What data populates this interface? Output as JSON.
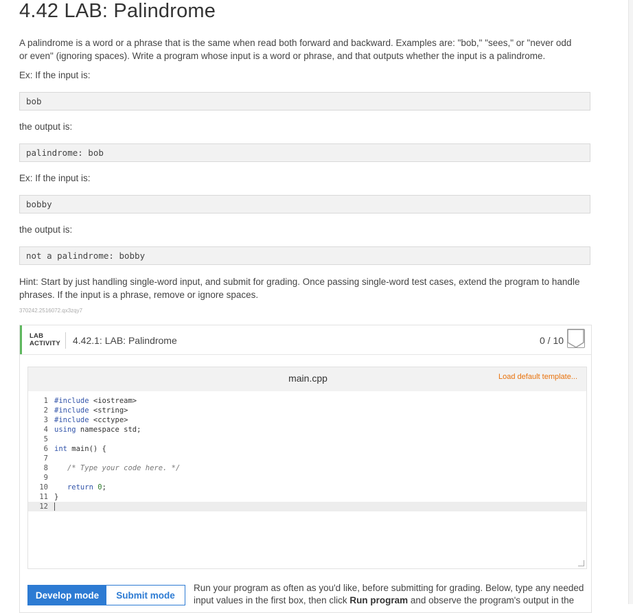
{
  "title": "4.42 LAB: Palindrome",
  "description": "A palindrome is a word or a phrase that is the same when read both forward and backward. Examples are: \"bob,\" \"sees,\" or \"never odd or even\" (ignoring spaces). Write a program whose input is a word or phrase, and that outputs whether the input is a palindrome.",
  "examples": [
    {
      "input_label": "Ex: If the input is:",
      "input": "bob",
      "output_label": "the output is:",
      "output": "palindrome: bob"
    },
    {
      "input_label": "Ex: If the input is:",
      "input": "bobby",
      "output_label": "the output is:",
      "output": "not a palindrome: bobby"
    }
  ],
  "hint": "Hint: Start by just handling single-word input, and submit for grading. Once passing single-word test cases, extend the program to handle phrases. If the input is a phrase, remove or ignore spaces.",
  "small_id": "370242.2516072.qx3zqy7",
  "lab": {
    "tag_line1": "LAB",
    "tag_line2": "ACTIVITY",
    "title": "4.42.1: LAB: Palindrome",
    "score": "0 / 10"
  },
  "editor": {
    "filename": "main.cpp",
    "load_default": "Load default template...",
    "line_numbers": [
      "1",
      "2",
      "3",
      "4",
      "5",
      "6",
      "7",
      "8",
      "9",
      "10",
      "11",
      "12"
    ]
  },
  "modes": {
    "develop": "Develop mode",
    "submit": "Submit mode"
  },
  "run_text": {
    "part1": "Run your program as often as you'd like, before submitting for grading. Below, type any needed input values in the first box, then click ",
    "bold": "Run program",
    "part2": " and observe the program's output in the"
  },
  "colors": {
    "accent_green": "#5fb85f",
    "accent_blue": "#2d7bd3",
    "link_orange": "#e8720c"
  }
}
